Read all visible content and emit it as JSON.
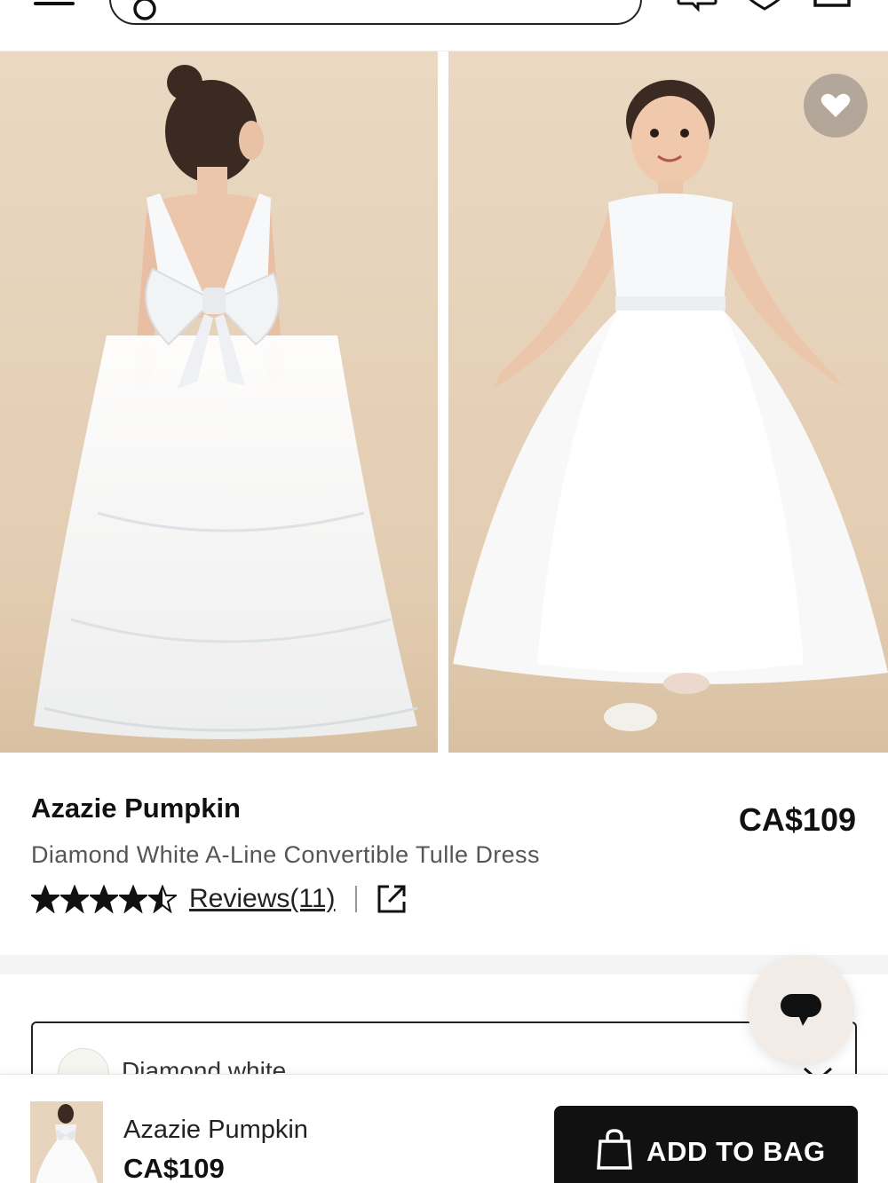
{
  "header": {
    "menu_icon": "hamburger-menu-icon",
    "search_icon": "search-icon",
    "icons": [
      "chat-icon",
      "heart-icon",
      "bag-icon"
    ]
  },
  "gallery": {
    "images": [
      "white flower girl dress back view with bow",
      "white flower girl dress front view"
    ],
    "wishlist_icon": "heart-icon"
  },
  "product": {
    "brand": "Azazie Pumpkin",
    "name": "Diamond White A-Line Convertible Tulle Dress",
    "price": "CA$109",
    "rating": 4.5,
    "reviews_label": "Reviews(11)",
    "share_icon": "external-link-icon"
  },
  "color_selector": {
    "selected": "Diamond white",
    "swatch_color": "#f6f6f1"
  },
  "chat": {
    "icon": "chat-bubble-icon"
  },
  "sticky_bar": {
    "name": "Azazie Pumpkin",
    "price": "CA$109",
    "button_label": "ADD TO BAG"
  },
  "colors": {
    "text": "#111111",
    "muted": "#555555",
    "button_bg": "#111111",
    "photo_bg": "#e7d4bc"
  }
}
